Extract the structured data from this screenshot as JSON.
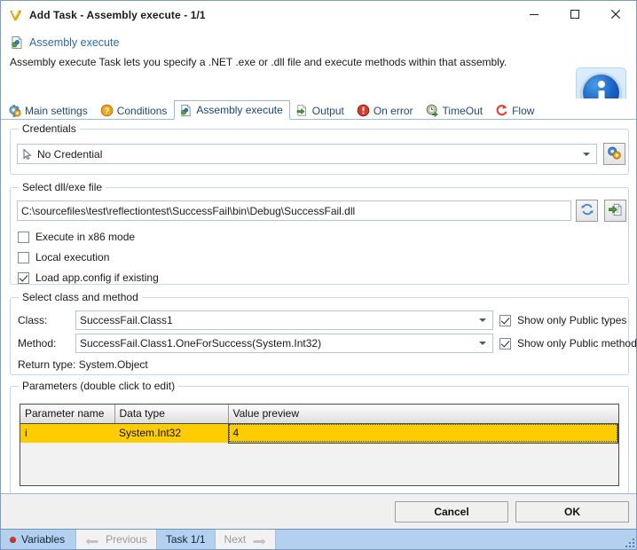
{
  "window": {
    "title": "Add Task - Assembly execute - 1/1",
    "title_icon": "visualcron-logo-icon",
    "minimize_label": "Minimize",
    "maximize_label": "Maximize",
    "close_label": "Close"
  },
  "header": {
    "icon": "assembly-execute-icon",
    "title": "Assembly execute",
    "description": "Assembly execute Task lets you specify a .NET .exe or .dll file and execute methods within that assembly.",
    "info_badge": "info-icon"
  },
  "tabs": [
    {
      "label": "Main settings",
      "icon": "gear-icon",
      "active": false
    },
    {
      "label": "Conditions",
      "icon": "question-icon",
      "active": false
    },
    {
      "label": "Assembly execute",
      "icon": "assembly-execute-icon",
      "active": true
    },
    {
      "label": "Output",
      "icon": "output-icon",
      "active": false
    },
    {
      "label": "On error",
      "icon": "error-icon",
      "active": false
    },
    {
      "label": "TimeOut",
      "icon": "timeout-icon",
      "active": false
    },
    {
      "label": "Flow",
      "icon": "flow-icon",
      "active": false
    }
  ],
  "credentials": {
    "group_label": "Credentials",
    "value": "No Credential",
    "icon": "cursor-icon",
    "settings_button": "credentials-gear-icon"
  },
  "file": {
    "group_label": "Select dll/exe file",
    "path": "C:\\sourcefiles\\test\\reflectiontest\\SuccessFail\\bin\\Debug\\SuccessFail.dll",
    "refresh_button": "refresh-icon",
    "browse_button": "browse-file-icon",
    "checkboxes": [
      {
        "label": "Execute in x86 mode",
        "checked": false
      },
      {
        "label": "Local execution",
        "checked": false
      },
      {
        "label": "Load app.config if existing",
        "checked": true
      }
    ]
  },
  "class_method": {
    "group_label": "Select class and method",
    "class_label": "Class:",
    "class_value": "SuccessFail.Class1",
    "method_label": "Method:",
    "method_value": "SuccessFail.Class1.OneForSuccess(System.Int32)",
    "return_type": "Return type: System.Object",
    "show_public_types": {
      "label": "Show only Public types",
      "checked": true
    },
    "show_public_methods": {
      "label": "Show only Public methods",
      "checked": true
    }
  },
  "parameters": {
    "group_label": "Parameters (double click to edit)",
    "columns": [
      "Parameter name",
      "Data type",
      "Value preview"
    ],
    "rows": [
      {
        "name": "i",
        "type": "System.Int32",
        "value": "4",
        "selected": true
      }
    ]
  },
  "footer": {
    "cancel_label": "Cancel",
    "ok_label": "OK"
  },
  "statusbar": {
    "variables_label": "Variables",
    "previous_label": "Previous",
    "task_label": "Task 1/1",
    "next_label": "Next"
  },
  "colors": {
    "accent": "#b3d0ef",
    "tab_text": "#20497a",
    "link": "#2b6ca8",
    "selection": "#ffcc00",
    "border": "#9ab8d8"
  }
}
